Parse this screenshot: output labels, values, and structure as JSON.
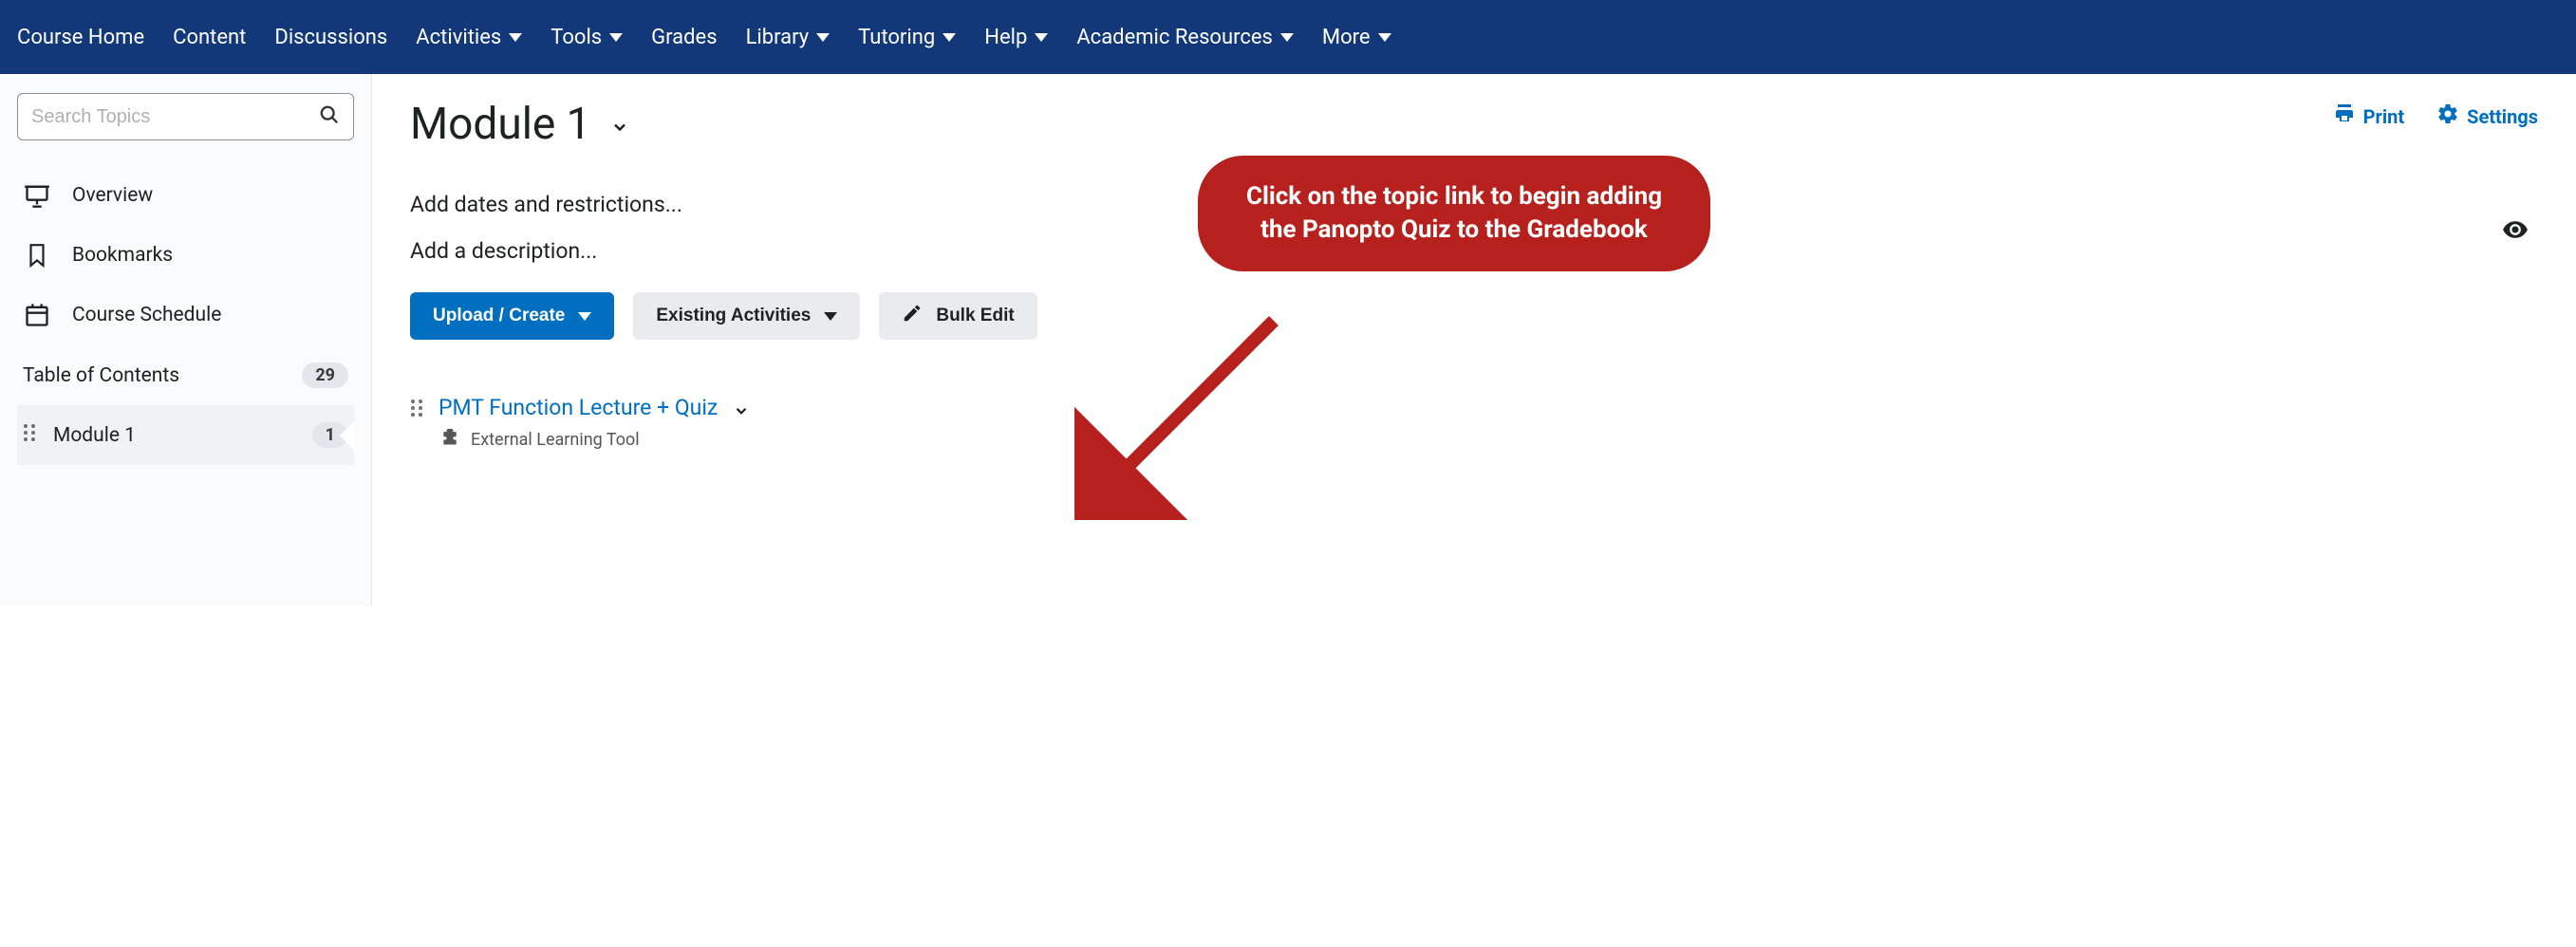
{
  "navbar": {
    "items": [
      {
        "label": "Course Home",
        "hasDropdown": false
      },
      {
        "label": "Content",
        "hasDropdown": false
      },
      {
        "label": "Discussions",
        "hasDropdown": false
      },
      {
        "label": "Activities",
        "hasDropdown": true
      },
      {
        "label": "Tools",
        "hasDropdown": true
      },
      {
        "label": "Grades",
        "hasDropdown": false
      },
      {
        "label": "Library",
        "hasDropdown": true
      },
      {
        "label": "Tutoring",
        "hasDropdown": true
      },
      {
        "label": "Help",
        "hasDropdown": true
      },
      {
        "label": "Academic Resources",
        "hasDropdown": true
      },
      {
        "label": "More",
        "hasDropdown": true
      }
    ]
  },
  "sidebar": {
    "search_placeholder": "Search Topics",
    "overview_label": "Overview",
    "bookmarks_label": "Bookmarks",
    "schedule_label": "Course Schedule",
    "toc_label": "Table of Contents",
    "toc_count": "29",
    "module_label": "Module 1",
    "module_count": "1"
  },
  "main": {
    "title": "Module 1",
    "print_label": "Print",
    "settings_label": "Settings",
    "dates_text": "Add dates and restrictions...",
    "desc_text": "Add a description...",
    "upload_label": "Upload / Create",
    "existing_label": "Existing Activities",
    "bulkedit_label": "Bulk Edit",
    "topic_link": "PMT Function Lecture + Quiz",
    "topic_subtype": "External Learning Tool"
  },
  "callout": {
    "text": "Click on the topic link to begin adding the Panopto Quiz to the Gradebook",
    "color": "#b6211e"
  }
}
